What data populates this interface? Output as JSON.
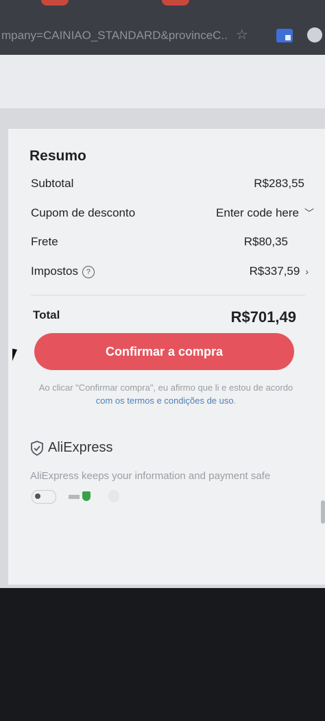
{
  "browser": {
    "url": "mpany=CAINIAO_STANDARD&provinceC..."
  },
  "summary": {
    "title": "Resumo",
    "subtotal_label": "Subtotal",
    "subtotal_value": "R$283,55",
    "coupon_label": "Cupom de desconto",
    "coupon_value": "Enter code here",
    "shipping_label": "Frete",
    "shipping_value": "R$80,35",
    "taxes_label": "Impostos",
    "taxes_value": "R$337,59",
    "total_label": "Total",
    "total_value": "R$701,49"
  },
  "actions": {
    "confirm_label": "Confirmar a compra"
  },
  "legal": {
    "prefix": "Ao clicar \"Confirmar compra\", eu afirmo que li e estou de acordo ",
    "link": "com os termos e condições de uso",
    "suffix": "."
  },
  "trust": {
    "brand": "AliExpress",
    "safe_text": "AliExpress keeps your information and payment safe"
  },
  "colors": {
    "accent": "#e5545d",
    "link": "#4f7fb6"
  }
}
